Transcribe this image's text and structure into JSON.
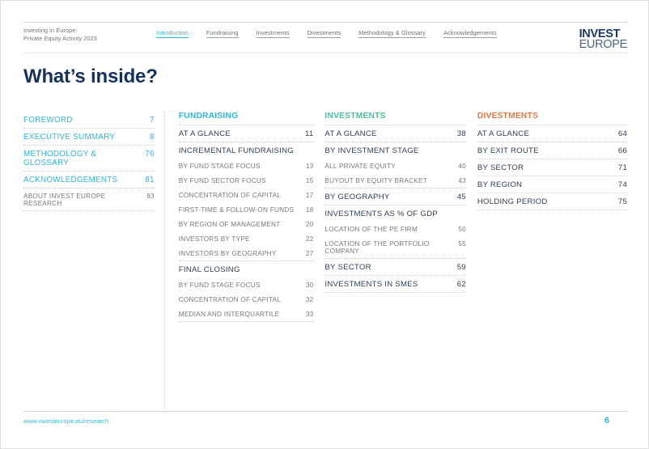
{
  "header": {
    "doc_title": "Investing in Europe:\nPrivate Equity Activity 2023",
    "nav": [
      {
        "label": "Introduction",
        "active": true
      },
      {
        "label": "Fundraising",
        "active": false
      },
      {
        "label": "Investments",
        "active": false
      },
      {
        "label": "Divestments",
        "active": false
      },
      {
        "label": "Methodology & Glossary",
        "active": false
      },
      {
        "label": "Acknowledgements",
        "active": false
      }
    ],
    "logo_line1": "INVEST",
    "logo_line2": "EUROPE"
  },
  "page_title": "What’s inside?",
  "colors": {
    "accent_cyan": "#2cb7dc",
    "accent_green": "#4cbfa0",
    "accent_orange": "#e8763c",
    "navy": "#16325c",
    "body_gray": "#73797f"
  },
  "columns": [
    {
      "id": "contents",
      "heading": "",
      "heading_color": "",
      "rows": [
        {
          "label": "FOREWORD",
          "page": "7",
          "level": "accent",
          "rule": false
        },
        {
          "label": "EXECUTIVE SUMMARY",
          "page": "8",
          "level": "accent",
          "rule": true
        },
        {
          "label": "METHODOLOGY & GLOSSARY",
          "page": "76",
          "level": "accent",
          "rule": true
        },
        {
          "label": "ACKNOWLEDGEMENTS",
          "page": "81",
          "level": "accent",
          "rule": true
        },
        {
          "label": "ABOUT INVEST EUROPE RESEARCH",
          "page": "83",
          "level": "sub",
          "rule": true
        }
      ]
    },
    {
      "id": "fundraising",
      "heading": "FUNDRAISING",
      "heading_color": "#2cb7dc",
      "rows": [
        {
          "label": "AT A GLANCE",
          "page": "11",
          "level": "major",
          "rule": true
        },
        {
          "label": "INCREMENTAL FUNDRAISING",
          "page": "",
          "level": "major",
          "rule": true
        },
        {
          "label": "BY FUND STAGE FOCUS",
          "page": "13",
          "level": "sub",
          "rule": false
        },
        {
          "label": "BY FUND SECTOR FOCUS",
          "page": "15",
          "level": "sub",
          "rule": false
        },
        {
          "label": "CONCENTRATION OF CAPITAL",
          "page": "17",
          "level": "sub",
          "rule": false
        },
        {
          "label": "FIRST-TIME & FOLLOW-ON FUNDS",
          "page": "18",
          "level": "sub",
          "rule": false
        },
        {
          "label": "BY REGION OF MANAGEMENT",
          "page": "20",
          "level": "sub",
          "rule": false
        },
        {
          "label": "INVESTORS BY TYPE",
          "page": "22",
          "level": "sub",
          "rule": false
        },
        {
          "label": "INVESTORS BY GEOGRAPHY",
          "page": "27",
          "level": "sub",
          "rule": false
        },
        {
          "label": "FINAL CLOSING",
          "page": "",
          "level": "major",
          "rule": true
        },
        {
          "label": "BY FUND STAGE FOCUS",
          "page": "30",
          "level": "sub",
          "rule": false
        },
        {
          "label": "CONCENTRATION OF CAPITAL",
          "page": "32",
          "level": "sub",
          "rule": false
        },
        {
          "label": "MEDIAN AND INTERQUARTILE",
          "page": "33",
          "level": "sub",
          "rule": false
        }
      ]
    },
    {
      "id": "investments",
      "heading": "INVESTMENTS",
      "heading_color": "#4cbfa0",
      "rows": [
        {
          "label": "AT A GLANCE",
          "page": "38",
          "level": "major",
          "rule": true
        },
        {
          "label": "BY INVESTMENT STAGE",
          "page": "",
          "level": "major",
          "rule": true
        },
        {
          "label": "ALL PRIVATE EQUITY",
          "page": "40",
          "level": "sub",
          "rule": false
        },
        {
          "label": "BUYOUT BY EQUITY BRACKET",
          "page": "43",
          "level": "sub",
          "rule": false
        },
        {
          "label": "BY GEOGRAPHY",
          "page": "45",
          "level": "major",
          "rule": true
        },
        {
          "label": "INVESTMENTS AS % OF GDP",
          "page": "",
          "level": "major",
          "rule": true
        },
        {
          "label": "LOCATION OF THE PE FIRM",
          "page": "50",
          "level": "sub",
          "rule": false
        },
        {
          "label": "LOCATION OF THE PORTFOLIO COMPANY",
          "page": "55",
          "level": "sub",
          "rule": false
        },
        {
          "label": "BY SECTOR",
          "page": "59",
          "level": "major",
          "rule": true
        },
        {
          "label": "INVESTMENTS IN SMES",
          "page": "62",
          "level": "major",
          "rule": true
        }
      ]
    },
    {
      "id": "divestments",
      "heading": "DIVESTMENTS",
      "heading_color": "#e8763c",
      "rows": [
        {
          "label": "AT A GLANCE",
          "page": "64",
          "level": "major",
          "rule": true
        },
        {
          "label": "BY EXIT ROUTE",
          "page": "66",
          "level": "major",
          "rule": true
        },
        {
          "label": "BY SECTOR",
          "page": "71",
          "level": "major",
          "rule": true
        },
        {
          "label": "BY REGION",
          "page": "74",
          "level": "major",
          "rule": true
        },
        {
          "label": "HOLDING PERIOD",
          "page": "75",
          "level": "major",
          "rule": true
        }
      ]
    }
  ],
  "footer": {
    "link": "www.investeurope.eu/research",
    "page_number": "6"
  }
}
